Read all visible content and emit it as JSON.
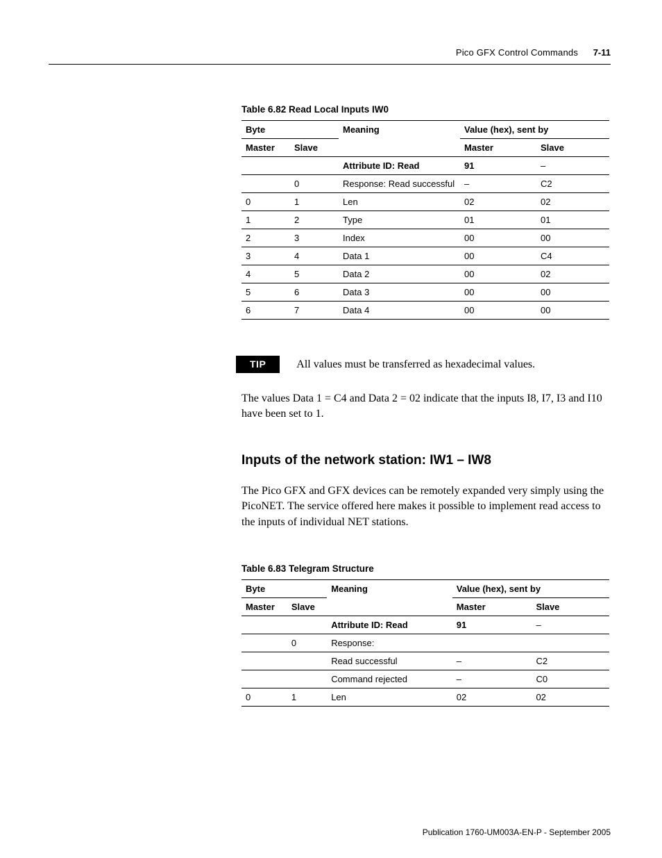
{
  "header": {
    "title": "Pico GFX Control Commands",
    "page_num": "7-11"
  },
  "table1": {
    "caption": "Table 6.82 Read Local Inputs IW0",
    "head": {
      "byte": "Byte",
      "meaning": "Meaning",
      "value": "Value (hex), sent by",
      "master": "Master",
      "slave": "Slave"
    },
    "rows": [
      {
        "m": "",
        "s": "",
        "meaning": "Attribute ID: Read",
        "vm": "91",
        "vs": "–",
        "bold": true
      },
      {
        "m": "",
        "s": "0",
        "meaning": "Response: Read successful",
        "vm": "–",
        "vs": "C2"
      },
      {
        "m": "0",
        "s": "1",
        "meaning": "Len",
        "vm": "02",
        "vs": "02"
      },
      {
        "m": "1",
        "s": "2",
        "meaning": "Type",
        "vm": "01",
        "vs": "01"
      },
      {
        "m": "2",
        "s": "3",
        "meaning": "Index",
        "vm": "00",
        "vs": "00"
      },
      {
        "m": "3",
        "s": "4",
        "meaning": "Data 1",
        "vm": "00",
        "vs": "C4"
      },
      {
        "m": "4",
        "s": "5",
        "meaning": "Data 2",
        "vm": "00",
        "vs": "02"
      },
      {
        "m": "5",
        "s": "6",
        "meaning": "Data 3",
        "vm": "00",
        "vs": "00"
      },
      {
        "m": "6",
        "s": "7",
        "meaning": "Data 4",
        "vm": "00",
        "vs": "00"
      }
    ]
  },
  "tip": {
    "label": "TIP",
    "text": "All values must be transferred as hexadecimal values."
  },
  "para1": "The values Data 1 = C4 and Data 2 = 02 indicate that the inputs I8, I7, I3 and I10 have been set to 1.",
  "section_heading": "Inputs of the network station: IW1 – IW8",
  "para2": "The Pico GFX and GFX devices can be remotely expanded very simply using the PicoNET. The service offered here makes it possible to implement read access to the inputs of individual NET stations.",
  "table2": {
    "caption": "Table 6.83 Telegram Structure",
    "head": {
      "byte": "Byte",
      "meaning": "Meaning",
      "value": "Value (hex), sent by",
      "master": "Master",
      "slave": "Slave"
    },
    "rows": [
      {
        "m": "",
        "s": "",
        "meaning": "Attribute ID: Read",
        "vm": "91",
        "vs": "–",
        "bold": true
      },
      {
        "m": "",
        "s": "0",
        "meaning": "Response:",
        "vm": "",
        "vs": ""
      },
      {
        "m": "",
        "s": "",
        "meaning": "Read successful",
        "vm": "–",
        "vs": "C2"
      },
      {
        "m": "",
        "s": "",
        "meaning": "Command rejected",
        "vm": "–",
        "vs": "C0"
      },
      {
        "m": "0",
        "s": "1",
        "meaning": "Len",
        "vm": "02",
        "vs": "02"
      }
    ]
  },
  "footer": "Publication 1760-UM003A-EN-P - September 2005"
}
